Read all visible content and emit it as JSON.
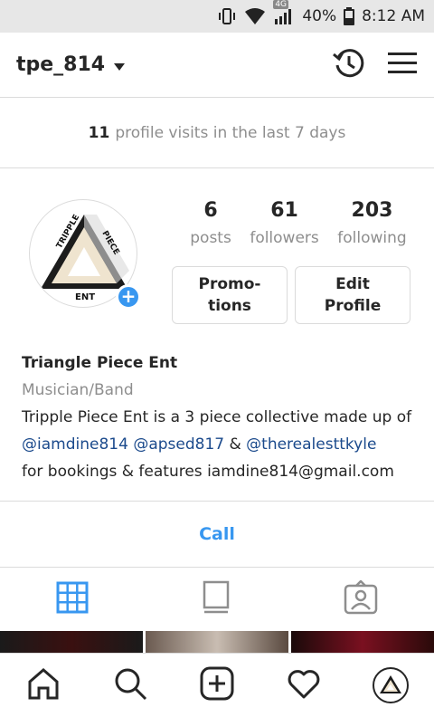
{
  "status_bar": {
    "network": "4G",
    "battery": "40%",
    "time": "8:12 AM"
  },
  "header": {
    "username": "tpe_814"
  },
  "visits": {
    "count": "11",
    "text": "profile visits in the last 7 days"
  },
  "stats": [
    {
      "value": "6",
      "label": "posts"
    },
    {
      "value": "61",
      "label": "followers"
    },
    {
      "value": "203",
      "label": "following"
    }
  ],
  "buttons": {
    "promotions": "Promo-\ntions",
    "edit_profile": "Edit\nProfile"
  },
  "bio": {
    "name": "Triangle Piece Ent",
    "category": "Musician/Band",
    "line1": "Tripple Piece Ent is a 3 piece collective made up of",
    "mention1": "@iamdine814",
    "mention2": "@apsed817",
    "amp": "&",
    "mention3": "@therealesttkyle",
    "line3": "for bookings & features iamdine814@gmail.com"
  },
  "call": {
    "label": "Call"
  },
  "logo": {
    "top_left": "TRIPPLE",
    "top_right": "PIECE",
    "bottom": "ENT"
  },
  "colors": {
    "accent": "#3897f0",
    "mention": "#1b4a8c",
    "muted": "#8e8e8e",
    "border": "#dbdbdb"
  },
  "icons": {
    "status": [
      "vibrate-icon",
      "wifi-icon",
      "signal-icon",
      "battery-icon"
    ],
    "header": [
      "archive-history-icon",
      "menu-icon"
    ],
    "tabs": [
      "grid-icon",
      "igtv-icon",
      "tagged-icon"
    ],
    "nav": [
      "home-icon",
      "search-icon",
      "add-icon",
      "heart-icon",
      "profile-avatar"
    ]
  }
}
